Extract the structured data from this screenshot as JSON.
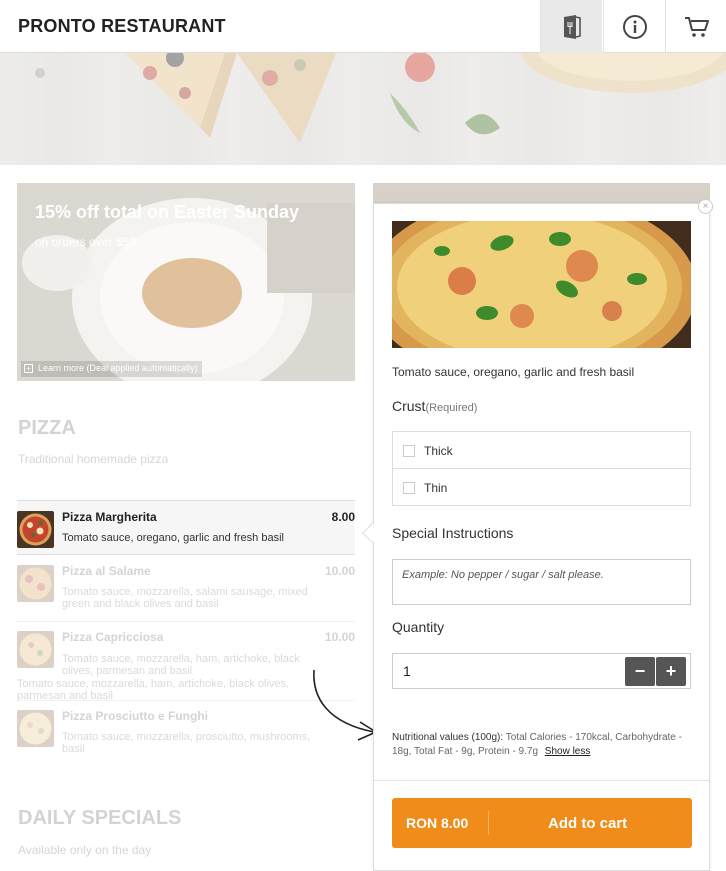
{
  "header": {
    "brand": "PRONTO RESTAURANT",
    "icons": [
      "menu-icon",
      "info-icon",
      "cart-icon"
    ]
  },
  "promo": {
    "title": "15% off total on Easter Sunday",
    "subtitle": "on orders over $50",
    "learn_more": "Learn more (Deal applied automatically)"
  },
  "sections": [
    {
      "title": "PIZZA",
      "subtitle": "Traditional homemade pizza",
      "items": [
        {
          "name": "Pizza Margherita",
          "price": "8.00",
          "desc": "Tomato sauce, oregano, garlic and fresh basil",
          "selected": true
        },
        {
          "name": "Pizza al Salame",
          "price": "10.00",
          "desc": "Tomato sauce, mozzarella, salami sausage, mixed green and black olives and basil",
          "selected": false
        },
        {
          "name": "Pizza Capricciosa",
          "price": "10.00",
          "desc": "Tomato sauce, mozzarella, ham, artichoke, black olives, parmesan and basil",
          "desc2": "Tomato sauce, mozzarella, ham, artichoke, black olives, parmesan and basil",
          "selected": false
        },
        {
          "name": "Pizza Prosciutto e Funghi",
          "price": "10.00",
          "desc": "Tomato sauce, mozzarella, prosciutto, mushrooms, basil",
          "selected": false
        }
      ]
    },
    {
      "title": "DAILY SPECIALS",
      "subtitle": "Available only on the day"
    }
  ],
  "panel": {
    "close": "×",
    "description": "Tomato sauce, oregano, garlic and fresh basil",
    "crust_label": "Crust",
    "crust_required": "(Required)",
    "crust_options": [
      "Thick",
      "Thin"
    ],
    "special_label": "Special Instructions",
    "special_placeholder": "Example: No pepper / sugar / salt please.",
    "quantity_label": "Quantity",
    "quantity_value": "1",
    "minus": "−",
    "plus": "+",
    "nutrition_label": "Nutritional values (100g):",
    "nutrition_text": "Total Calories - 170kcal, Carbohydrate - 18g, Total Fat - 9g, Protein - 9.7g",
    "show_less": "Show less",
    "cart_price": "RON 8.00",
    "add_to_cart": "Add to cart",
    "accent_color": "#f08c1a"
  }
}
